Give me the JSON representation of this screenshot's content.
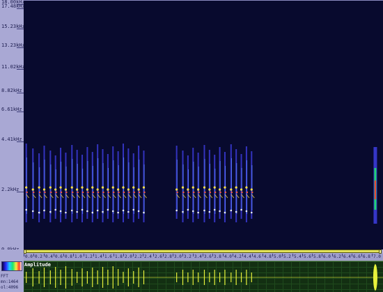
{
  "frequency_axis": {
    "labels": [
      {
        "text": "18.00kHz",
        "frac": 0.005
      },
      {
        "text": "17.48kHz",
        "frac": 0.022
      },
      {
        "text": "15.23kHz",
        "frac": 0.102
      },
      {
        "text": "13.23kHz",
        "frac": 0.18
      },
      {
        "text": "11.02kHz",
        "frac": 0.265
      },
      {
        "text": "8.82kHz",
        "frac": 0.36
      },
      {
        "text": "6.61kHz",
        "frac": 0.435
      },
      {
        "text": "4.41kHz",
        "frac": 0.555
      },
      {
        "text": "2.2kHz",
        "frac": 0.758
      },
      {
        "text": "0.0kHz",
        "frac": 0.998
      }
    ]
  },
  "time_axis": {
    "labels": [
      "0.0",
      "0.2",
      "0.4",
      "0.6",
      "0.8",
      "1.0",
      "1.2",
      "1.4",
      "1.6",
      "1.8",
      "2.0",
      "2.2",
      "2.4",
      "2.6",
      "2.8",
      "3.0",
      "3.2",
      "3.4",
      "3.6",
      "3.8",
      "4.0",
      "4.2",
      "4.4",
      "4.6",
      "4.8",
      "5.0",
      "5.2",
      "5.4",
      "5.6",
      "5.8",
      "6.0",
      "6.2",
      "6.4",
      "6.6",
      "6.8",
      "7.0"
    ]
  },
  "status": {
    "fft": "FFT",
    "min_value": "mn:1464",
    "max_value": "ol:4096"
  },
  "amplitude_panel": {
    "label": "Amplitude"
  },
  "colors": {
    "spectrogram_bg": "#080a2e",
    "waveform": "#e6f23c",
    "axis_bg": "#a9a8d4"
  },
  "calls": {
    "group1_times": [
      0.05,
      0.18,
      0.3,
      0.4,
      0.52,
      0.62,
      0.72,
      0.82,
      0.94,
      1.04,
      1.14,
      1.24,
      1.34,
      1.44,
      1.54,
      1.64,
      1.74,
      1.84,
      1.94,
      2.04,
      2.14,
      2.24,
      2.34
    ],
    "group2_times": [
      2.98,
      3.1,
      3.2,
      3.3,
      3.4,
      3.52,
      3.62,
      3.72,
      3.82,
      3.92,
      4.04,
      4.14,
      4.24,
      4.34,
      4.44
    ],
    "final_event_time": 6.85
  }
}
